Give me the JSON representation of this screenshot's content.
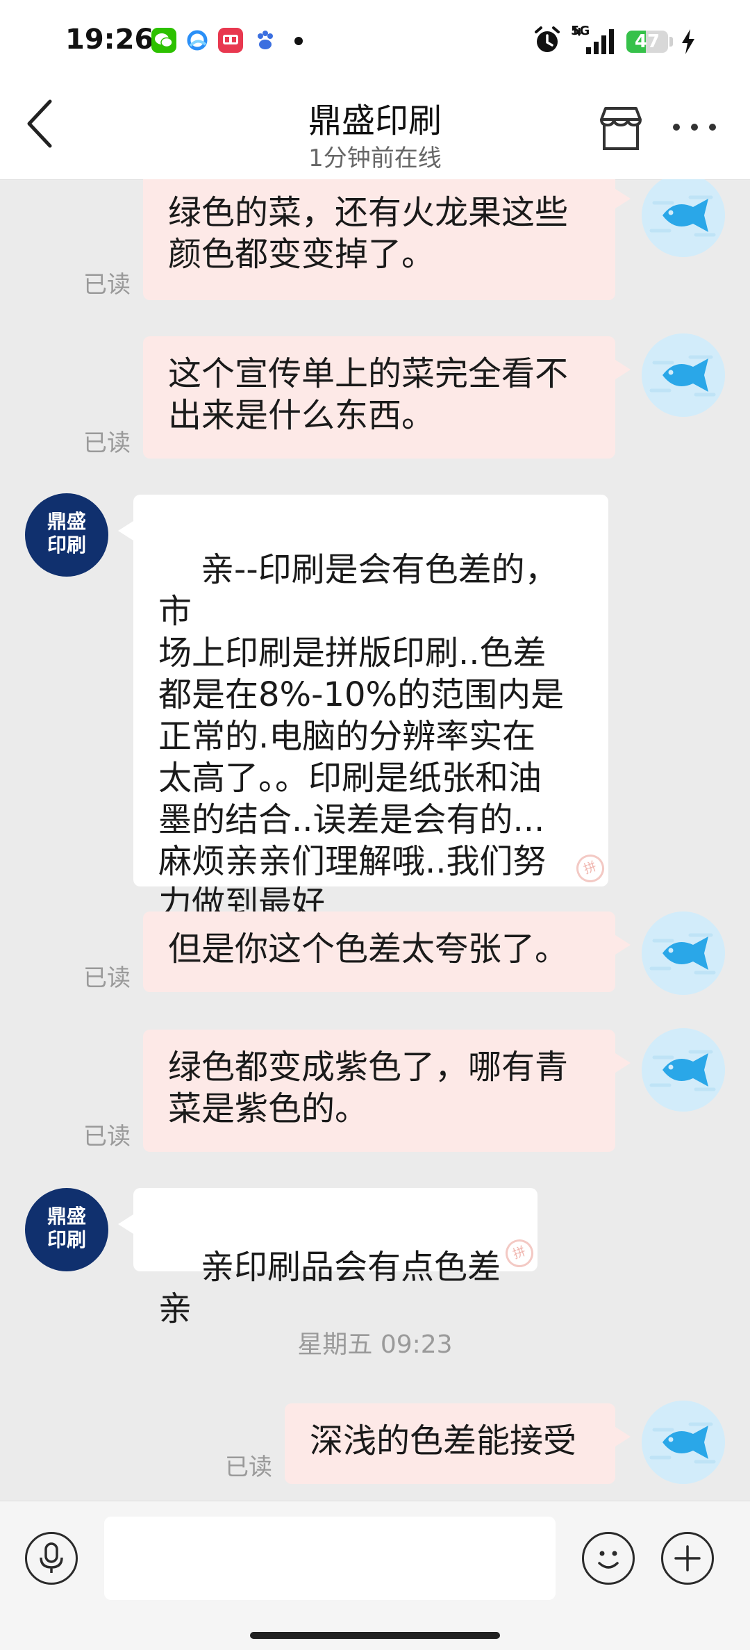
{
  "status_bar": {
    "time": "19:26",
    "network": "5G",
    "battery": "47",
    "battery_level": 0.47,
    "icons": [
      "wechat-icon",
      "browser-icon",
      "food-app-icon",
      "baidu-icon",
      "alarm-icon",
      "signal-icon",
      "battery-icon",
      "charging-icon"
    ]
  },
  "header": {
    "title": "鼎盛印刷",
    "subtitle": "1分钟前在线"
  },
  "shop_avatar": {
    "line1": "鼎盛",
    "line2": "印刷"
  },
  "messages": [
    {
      "from": "me",
      "text": "绿色的菜，还有火龙果这些\n颜色都变变掉了。",
      "status": "已读"
    },
    {
      "from": "me",
      "text": "这个宣传单上的菜完全看不\n出来是什么东西。",
      "status": "已读"
    },
    {
      "from": "shop",
      "text": "亲--印刷是会有色差的，市\n场上印刷是拼版印刷..色差\n都是在8%-10%的范围内是\n正常的.电脑的分辨率实在\n太高了。。印刷是纸张和油\n墨的结合..误差是会有的...\n麻烦亲亲们理解哦..我们努\n力做到最好"
    },
    {
      "from": "me",
      "text": "但是你这个色差太夸张了。",
      "status": "已读"
    },
    {
      "from": "me",
      "text": "绿色都变成紫色了，哪有青\n菜是紫色的。",
      "status": "已读"
    },
    {
      "from": "shop",
      "text": "亲印刷品会有点色差亲"
    },
    {
      "from": "me",
      "text": "深浅的色差能接受",
      "status": "已读"
    }
  ],
  "day_separator": "星期五 09:23",
  "input": {
    "placeholder": ""
  },
  "colors": {
    "my_bubble": "#fde9e7",
    "their_bubble": "#ffffff",
    "background": "#ebebeb",
    "my_avatar_fish": "#2aa7e8",
    "shop_avatar_bg": "#10306e"
  }
}
